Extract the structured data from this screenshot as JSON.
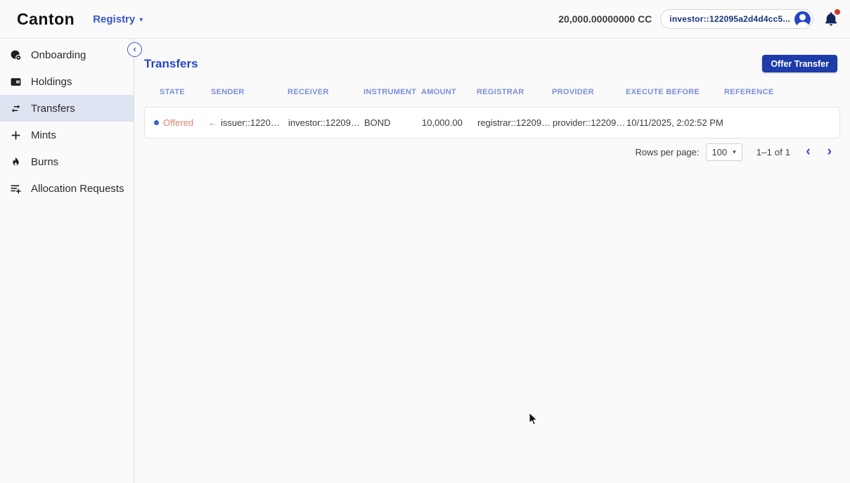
{
  "header": {
    "logo": "Canton",
    "app_selector": "Registry",
    "caret": "▾",
    "balance": "20,000.00000000 CC",
    "user_chip": "investor::122095a2d4d4cc5...",
    "icons": [
      "user-avatar-icon",
      "notification-bell-icon"
    ]
  },
  "sidebar": {
    "collapse_glyph": "‹",
    "items": [
      {
        "label": "Onboarding",
        "icon": "onboarding-icon",
        "selected": false
      },
      {
        "label": "Holdings",
        "icon": "wallet-icon",
        "selected": false
      },
      {
        "label": "Transfers",
        "icon": "transfer-arrows-icon",
        "selected": true
      },
      {
        "label": "Mints",
        "icon": "plus-icon",
        "selected": false
      },
      {
        "label": "Burns",
        "icon": "flame-icon",
        "selected": false
      },
      {
        "label": "Allocation Requests",
        "icon": "list-plus-icon",
        "selected": false
      }
    ]
  },
  "main": {
    "title": "Transfers",
    "offer_button": "Offer Transfer",
    "table": {
      "columns": [
        "STATE",
        "SENDER",
        "RECEIVER",
        "INSTRUMENT",
        "AMOUNT",
        "REGISTRAR",
        "PROVIDER",
        "EXECUTE BEFORE",
        "REFERENCE"
      ],
      "rows": [
        {
          "state": "Offered",
          "direction_arrow": "←",
          "sender": "issuer::1220…",
          "receiver": "investor::12209…",
          "instrument": "BOND",
          "amount": "10,000.00",
          "registrar": "registrar::12209…",
          "provider": "provider::12209…",
          "execute_before": "10/11/2025, 2:02:52 PM",
          "reference": ""
        }
      ]
    },
    "pagination": {
      "rows_per_page_label": "Rows per page:",
      "rows_per_page_value": "100",
      "range": "1–1 of 1",
      "prev_glyph": "‹",
      "next_glyph": "›"
    }
  },
  "colors": {
    "accent_blue": "#2847c5",
    "header_link_blue": "#3a57c9",
    "column_header_blue": "#7b8ed8",
    "state_offered_coral": "#d98673",
    "state_dot_blue": "#3d5ecf",
    "direction_arrow_green": "#7fa07c",
    "button_blue": "#1d3caa",
    "chip_text_navy": "#16337d",
    "notification_red": "#d23b2e",
    "selected_item_bg": "#dde3f0",
    "page_bg": "#fafafa"
  }
}
